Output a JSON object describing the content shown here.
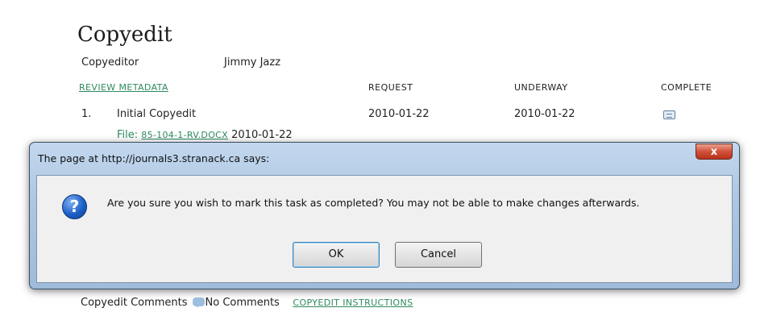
{
  "page": {
    "title": "Copyedit",
    "copyeditor_label": "Copyeditor",
    "copyeditor_value": "Jimmy Jazz",
    "review_metadata_link": "REVIEW METADATA",
    "columns": {
      "request": "REQUEST",
      "underway": "UNDERWAY",
      "complete": "COMPLETE"
    },
    "row": {
      "number": "1.",
      "task": "Initial Copyedit",
      "request_date": "2010-01-22",
      "underway_date": "2010-01-22",
      "complete_icon": "envelope-icon"
    },
    "file": {
      "label": "File:",
      "link": "85-104-1-RV.DOCX",
      "date": "2010-01-22"
    },
    "bottom": {
      "comments_label": "Copyedit Comments",
      "comments_icon": "comment-icon",
      "no_comments": "No Comments",
      "instructions_link": "COPYEDIT INSTRUCTIONS"
    }
  },
  "dialog": {
    "title": "The page at http://journals3.stranack.ca says:",
    "close_label": "x",
    "icon": "question-icon",
    "message": "Are you sure you wish to mark this task as completed? You may not be able to make changes afterwards.",
    "ok_label": "OK",
    "cancel_label": "Cancel"
  },
  "colors": {
    "link": "#2e8a5f",
    "dialog_frame": "#adc6e2",
    "close_button": "#d2513a"
  }
}
